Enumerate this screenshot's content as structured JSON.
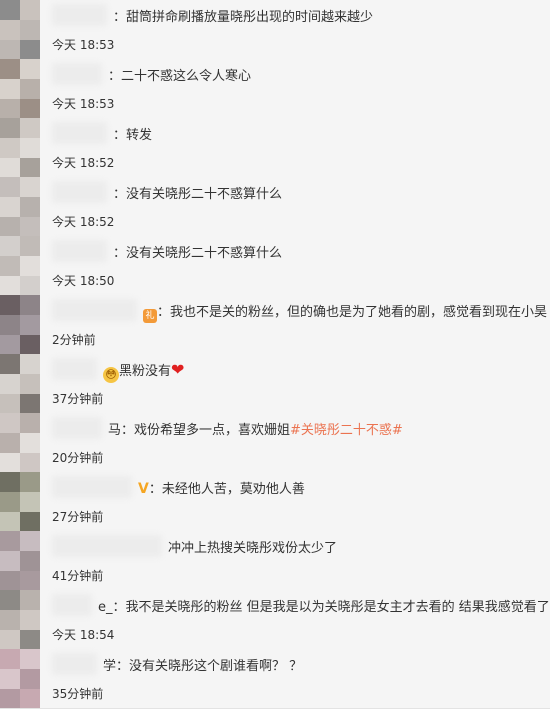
{
  "comments": [
    {
      "prefix": "：",
      "text": "甜筒拼命刷播放量晓彤出现的时间越来越少",
      "time": "今天 18:53"
    },
    {
      "prefix": "：",
      "text": "二十不惑这么令人寒心",
      "time": "今天 18:53"
    },
    {
      "prefix": "：",
      "text": "转发",
      "time": "今天 18:52"
    },
    {
      "prefix": "：",
      "text": "没有关晓彤二十不惑算什么",
      "time": "今天 18:52"
    },
    {
      "prefix": "：",
      "text": "没有关晓彤二十不惑算什么",
      "time": "今天 18:50"
    },
    {
      "prefix": "：",
      "text": "我也不是关的粉丝，但的确也是为了她看的剧，感觉看到现在小昊",
      "time": "2分钟前",
      "badge": "gift"
    },
    {
      "prefix": "",
      "text": "黑粉没有",
      "time": "37分钟前",
      "badge": "face",
      "trail": "heart"
    },
    {
      "prefix": "马：",
      "text": "戏份希望多一点，喜欢姗姐",
      "tag": "#关晓彤二十不惑#",
      "time": "20分钟前"
    },
    {
      "prefix": "：",
      "text": "未经他人苦，莫劝他人善",
      "time": "27分钟前",
      "badge": "v"
    },
    {
      "prefix": "",
      "text": "冲冲上热搜关晓彤戏份太少了",
      "time": "41分钟前"
    },
    {
      "prefix": "e_：",
      "text": "我不是关晓彤的粉丝 但是我是以为关晓彤是女主才去看的 结果我感觉看了",
      "time": "今天 18:54"
    },
    {
      "prefix": "学：",
      "text": "没有关晓彤这个剧谁看啊？ ？",
      "time": "35分钟前"
    }
  ],
  "icons": {
    "face": "😳",
    "heart": "❤",
    "v": "V",
    "gift": "礼"
  },
  "colors": {
    "tag": "#eb7350",
    "background": "#f5f5f5"
  }
}
